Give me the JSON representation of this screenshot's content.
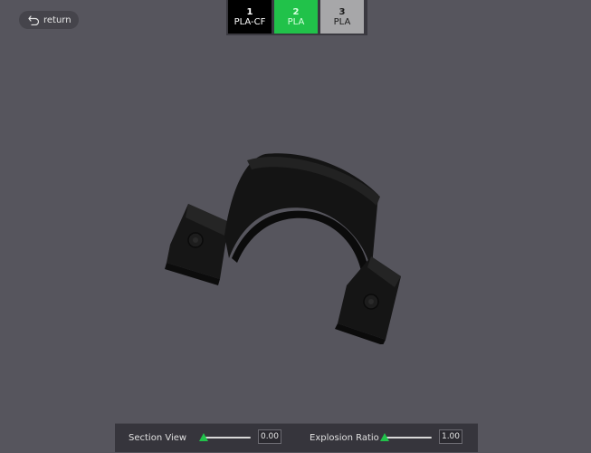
{
  "header": {
    "return_label": "return"
  },
  "filaments": [
    {
      "number": "1",
      "material": "PLA-CF",
      "color": "#000000"
    },
    {
      "number": "2",
      "material": "PLA",
      "color": "#21c24a"
    },
    {
      "number": "3",
      "material": "PLA",
      "color": "#a7a7a9"
    }
  ],
  "controls": {
    "section_view": {
      "label": "Section View",
      "value": "0.00",
      "fraction": 0.0
    },
    "explosion_ratio": {
      "label": "Explosion Ratio",
      "value": "1.00",
      "fraction": 0.0
    }
  },
  "colors": {
    "accent": "#21c24a",
    "background": "#56555d",
    "panel": "#36353c"
  },
  "icons": {
    "return": "return-arrow-icon"
  }
}
